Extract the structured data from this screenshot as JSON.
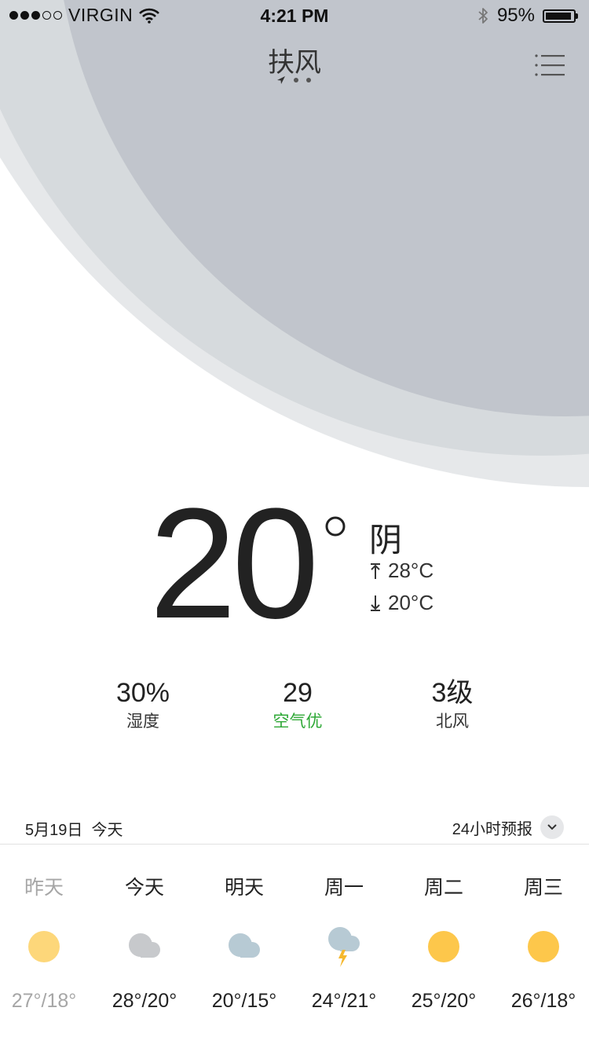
{
  "status_bar": {
    "carrier": "VIRGIN",
    "time": "4:21 PM",
    "battery": "95%",
    "signal_bars": 3,
    "battery_level": 0.95
  },
  "header": {
    "city": "扶风",
    "page_count": 3
  },
  "current": {
    "temperature": "20",
    "condition": "阴",
    "high": "28°C",
    "low": "20°C"
  },
  "stats": [
    {
      "value": "30%",
      "label": "湿度"
    },
    {
      "value": "29",
      "label": "空气优",
      "color": "#2ea836"
    },
    {
      "value": "3级",
      "label": "北风"
    }
  ],
  "forecast_header": {
    "date": "5月19日  今天",
    "hourly_label": "24小时预报"
  },
  "forecast": [
    {
      "day": "昨天",
      "icon": "sun-icon",
      "range": "27°/18°",
      "past": true
    },
    {
      "day": "今天",
      "icon": "cloud-icon",
      "range": "28°/20°"
    },
    {
      "day": "明天",
      "icon": "cloud-icon",
      "range": "20°/15°"
    },
    {
      "day": "周一",
      "icon": "thunderstorm-icon",
      "range": "24°/21°"
    },
    {
      "day": "周二",
      "icon": "sun-icon",
      "range": "25°/20°"
    },
    {
      "day": "周三",
      "icon": "sun-icon",
      "range": "26°/18°"
    }
  ],
  "colors": {
    "sun_past": "#fdd77a",
    "sun": "#fdc74b",
    "cloud_gray": "#c7c9cc",
    "cloud_blue": "#b7cad4",
    "lightning": "#f5b82e",
    "air_good": "#2ea836"
  }
}
